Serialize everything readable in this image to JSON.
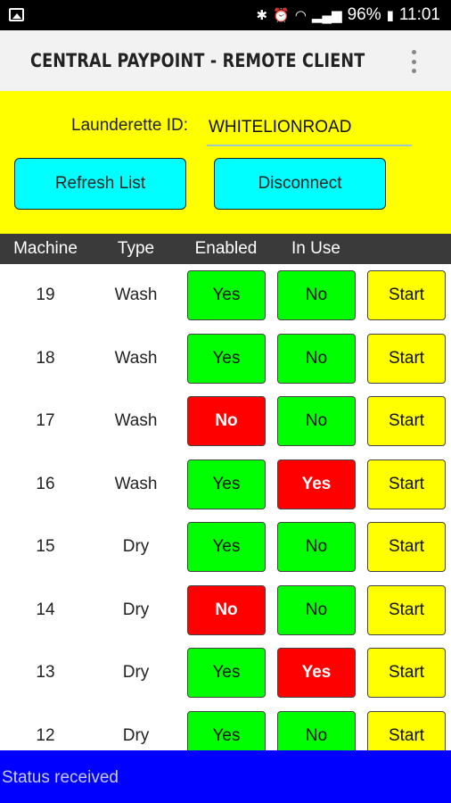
{
  "system_status": {
    "battery": "96%",
    "time": "11:01",
    "icons": [
      "gallery-icon",
      "bluetooth-icon",
      "alarm-icon",
      "wifi-icon",
      "signal-icon",
      "battery-icon"
    ]
  },
  "appbar": {
    "title": "CENTRAL PAYPOINT - REMOTE CLIENT",
    "overflow_icon": "more-vert-icon"
  },
  "form": {
    "id_label": "Launderette ID:",
    "id_value": "WHITELIONROAD",
    "refresh_label": "Refresh List",
    "disconnect_label": "Disconnect"
  },
  "table": {
    "headers": [
      "Machine",
      "Type",
      "Enabled",
      "In Use"
    ],
    "rows": [
      {
        "machine": "19",
        "type": "Wash",
        "enabled": "Yes",
        "in_use": "No",
        "action": "Start"
      },
      {
        "machine": "18",
        "type": "Wash",
        "enabled": "Yes",
        "in_use": "No",
        "action": "Start"
      },
      {
        "machine": "17",
        "type": "Wash",
        "enabled": "No",
        "in_use": "No",
        "action": "Start"
      },
      {
        "machine": "16",
        "type": "Wash",
        "enabled": "Yes",
        "in_use": "Yes",
        "action": "Start"
      },
      {
        "machine": "15",
        "type": "Dry",
        "enabled": "Yes",
        "in_use": "No",
        "action": "Start"
      },
      {
        "machine": "14",
        "type": "Dry",
        "enabled": "No",
        "in_use": "No",
        "action": "Start"
      },
      {
        "machine": "13",
        "type": "Dry",
        "enabled": "Yes",
        "in_use": "Yes",
        "action": "Start"
      },
      {
        "machine": "12",
        "type": "Dry",
        "enabled": "Yes",
        "in_use": "No",
        "action": "Start"
      }
    ]
  },
  "status_message": "Status received",
  "colors": {
    "panel": "#ffff00",
    "panel_button": "#00ffff",
    "good": "#00ff00",
    "bad": "#ff0000",
    "start": "#ffff00",
    "status_bar": "#0000ff",
    "header": "#3a3a3a"
  }
}
